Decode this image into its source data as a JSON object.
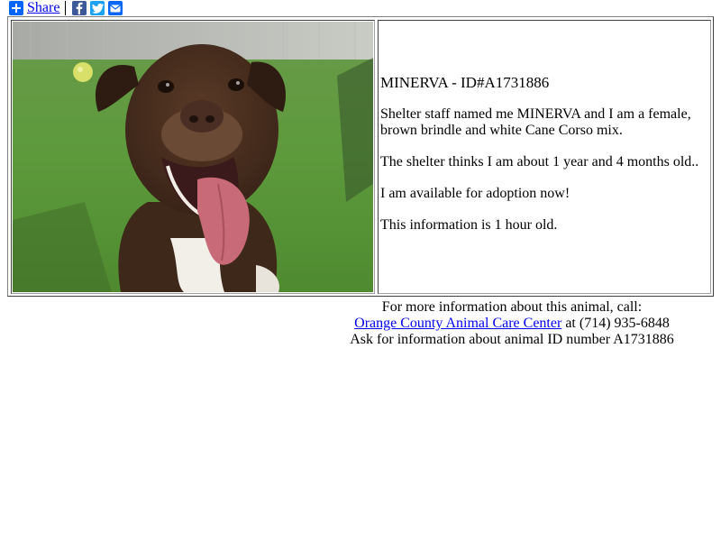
{
  "share_bar": {
    "share_label": "Share",
    "icons": [
      "plus-icon",
      "facebook-icon",
      "twitter-icon",
      "email-icon"
    ],
    "colors": {
      "plus": "#0166ff",
      "facebook": "#3b5998",
      "twitter": "#1da1f2",
      "email": "#0166ff"
    }
  },
  "animal": {
    "title": "MINERVA - ID#A1731886",
    "description_1": "Shelter staff named me MINERVA and I am a female, brown brindle and white Cane Corso mix.",
    "age_text": "The shelter thinks I am about 1 year and 4 months old..",
    "availability_text": "I am available for adoption now!",
    "freshness_text": "This information is 1 hour old."
  },
  "contact": {
    "intro": "For more information about this animal, call:",
    "shelter_name": "Orange County Animal Care Center",
    "phone_text": " at (714) 935-6848",
    "ask_text": "Ask for information about animal ID number A1731886"
  },
  "colors": {
    "link": "#0000ee"
  }
}
